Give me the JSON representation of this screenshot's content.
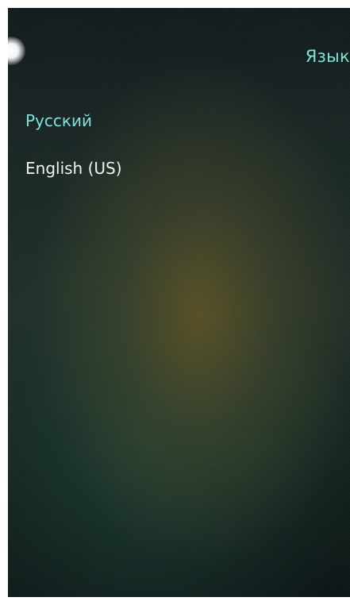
{
  "header": {
    "title": "Язык"
  },
  "languages": {
    "items": [
      {
        "label": "Русский",
        "selected": true
      },
      {
        "label": "English (US)",
        "selected": false
      }
    ]
  },
  "colors": {
    "accent": "#7fe3dc",
    "text": "#eef3f2"
  }
}
